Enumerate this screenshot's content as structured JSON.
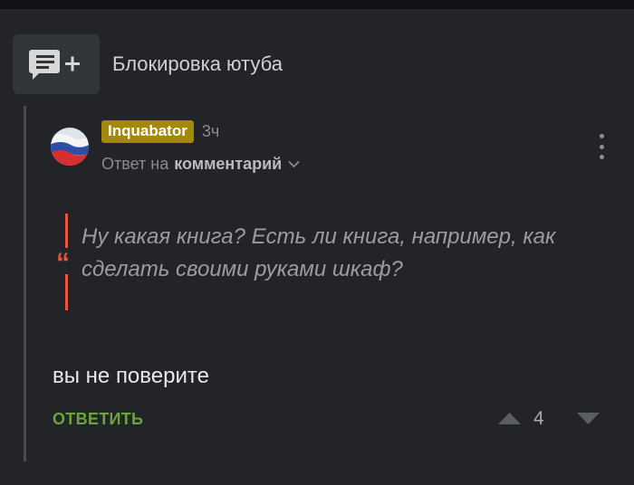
{
  "post": {
    "title": "Блокировка ютуба",
    "add_comment_icon": "comment-add-icon"
  },
  "comment": {
    "author": "Inquabator",
    "time": "3ч",
    "reply_prefix": "Ответ на",
    "reply_target": "комментарий",
    "quote": "Ну какая книга? Есть ли книга, например, как сделать своими руками шкаф?",
    "body": "вы не поверите",
    "reply_label": "ОТВЕТИТЬ",
    "rating": "4"
  },
  "colors": {
    "background": "#222427",
    "author_badge": "#a3880b",
    "quote_accent": "#e8573d",
    "reply_link": "#6aa33f"
  }
}
